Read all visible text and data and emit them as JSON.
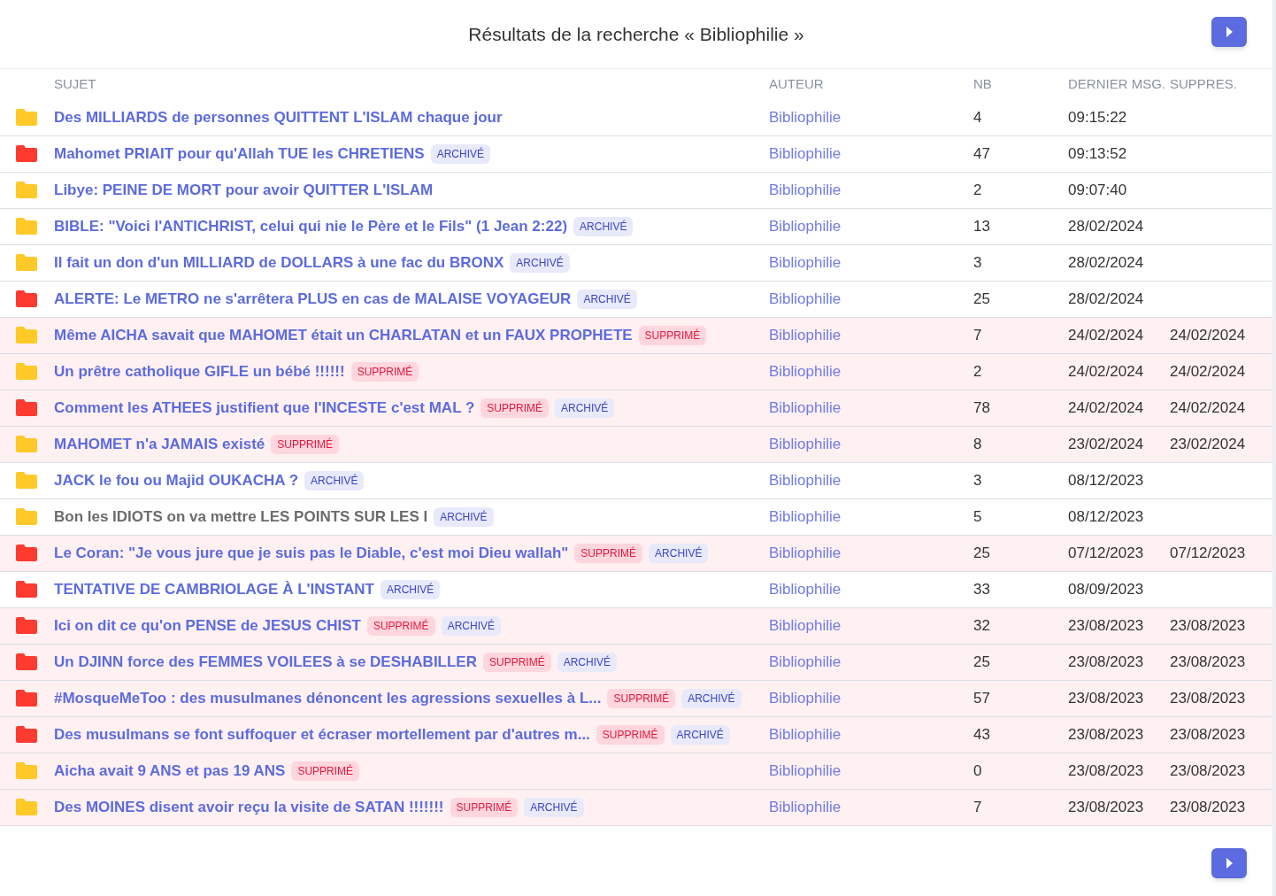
{
  "title": "Résultats de la recherche « Bibliophilie »",
  "columns": [
    "SUJET",
    "AUTEUR",
    "NB",
    "DERNIER MSG.",
    "SUPPRES."
  ],
  "rows": [
    {
      "color": "#ffc928",
      "subject": "Des MILLIARDS de personnes QUITTENT L'ISLAM chaque jour",
      "visited": false,
      "deleted": false,
      "badges": [],
      "author": "Bibliophilie",
      "count": "4",
      "last": "09:15:22"
    },
    {
      "color": "#ff3b2f",
      "subject": "Mahomet PRIAIT pour qu'Allah TUE les CHRETIENS",
      "visited": false,
      "deleted": false,
      "badges": [
        {
          "kind": "archived",
          "label": "ARCHIVÉ"
        }
      ],
      "author": "Bibliophilie",
      "count": "47",
      "last": "09:13:52"
    },
    {
      "color": "#ffc928",
      "subject": "Libye: PEINE DE MORT pour avoir QUITTER L'ISLAM",
      "visited": false,
      "deleted": false,
      "badges": [],
      "author": "Bibliophilie",
      "count": "2",
      "last": "09:07:40"
    },
    {
      "color": "#ffc928",
      "subject": "BIBLE: \"Voici l'ANTICHRIST, celui qui nie le Père et le Fils\" (1 Jean 2:22)",
      "visited": false,
      "deleted": false,
      "badges": [
        {
          "kind": "archived",
          "label": "ARCHIVÉ"
        }
      ],
      "author": "Bibliophilie",
      "count": "13",
      "last": "28/02/2024"
    },
    {
      "color": "#ffc928",
      "subject": "Il fait un don d'un MILLIARD de DOLLARS à une fac du BRONX",
      "visited": false,
      "deleted": false,
      "badges": [
        {
          "kind": "archived",
          "label": "ARCHIVÉ"
        }
      ],
      "author": "Bibliophilie",
      "count": "3",
      "last": "28/02/2024"
    },
    {
      "color": "#ff3b2f",
      "subject": "ALERTE: Le METRO ne s'arrêtera PLUS en cas de MALAISE VOYAGEUR",
      "visited": false,
      "deleted": false,
      "badges": [
        {
          "kind": "archived",
          "label": "ARCHIVÉ"
        }
      ],
      "author": "Bibliophilie",
      "count": "25",
      "last": "28/02/2024"
    },
    {
      "color": "#ffc928",
      "subject": "Même AICHA savait que MAHOMET était un CHARLATAN et un FAUX PROPHETE",
      "visited": false,
      "deleted": true,
      "badges": [
        {
          "kind": "deleted",
          "label": "SUPPRIMÉ"
        }
      ],
      "author": "Bibliophilie",
      "count": "7",
      "last": "24/02/2024",
      "removed": "24/02/2024"
    },
    {
      "color": "#ffc928",
      "subject": "Un prêtre catholique GIFLE un bébé !!!!!!",
      "visited": false,
      "deleted": true,
      "badges": [
        {
          "kind": "deleted",
          "label": "SUPPRIMÉ"
        }
      ],
      "author": "Bibliophilie",
      "count": "2",
      "last": "24/02/2024",
      "removed": "24/02/2024"
    },
    {
      "color": "#ff3b2f",
      "subject": "Comment les ATHEES justifient que l'INCESTE c'est MAL ?",
      "visited": false,
      "deleted": true,
      "badges": [
        {
          "kind": "deleted",
          "label": "SUPPRIMÉ"
        },
        {
          "kind": "archived",
          "label": "ARCHIVÉ"
        }
      ],
      "author": "Bibliophilie",
      "count": "78",
      "last": "24/02/2024",
      "removed": "24/02/2024"
    },
    {
      "color": "#ffc928",
      "subject": "MAHOMET n'a JAMAIS existé",
      "visited": false,
      "deleted": true,
      "badges": [
        {
          "kind": "deleted",
          "label": "SUPPRIMÉ"
        }
      ],
      "author": "Bibliophilie",
      "count": "8",
      "last": "23/02/2024",
      "removed": "23/02/2024"
    },
    {
      "color": "#ffc928",
      "subject": "JACK le fou ou Majid OUKACHA ?",
      "visited": false,
      "deleted": false,
      "badges": [
        {
          "kind": "archived",
          "label": "ARCHIVÉ"
        }
      ],
      "author": "Bibliophilie",
      "count": "3",
      "last": "08/12/2023"
    },
    {
      "color": "#ffc928",
      "subject": "Bon les IDIOTS on va mettre LES POINTS SUR LES I",
      "visited": true,
      "deleted": false,
      "badges": [
        {
          "kind": "archived",
          "label": "ARCHIVÉ"
        }
      ],
      "author": "Bibliophilie",
      "count": "5",
      "last": "08/12/2023"
    },
    {
      "color": "#ff3b2f",
      "subject": "Le Coran: \"Je vous jure que je suis pas le Diable, c'est moi Dieu wallah\"",
      "visited": false,
      "deleted": true,
      "badges": [
        {
          "kind": "deleted",
          "label": "SUPPRIMÉ"
        },
        {
          "kind": "archived",
          "label": "ARCHIVÉ"
        }
      ],
      "author": "Bibliophilie",
      "count": "25",
      "last": "07/12/2023",
      "removed": "07/12/2023"
    },
    {
      "color": "#ff3b2f",
      "subject": "TENTATIVE DE CAMBRIOLAGE À L'INSTANT",
      "visited": false,
      "deleted": false,
      "badges": [
        {
          "kind": "archived",
          "label": "ARCHIVÉ"
        }
      ],
      "author": "Bibliophilie",
      "count": "33",
      "last": "08/09/2023"
    },
    {
      "color": "#ff3b2f",
      "subject": "Ici on dit ce qu'on PENSE de JESUS CHIST",
      "visited": false,
      "deleted": true,
      "badges": [
        {
          "kind": "deleted",
          "label": "SUPPRIMÉ"
        },
        {
          "kind": "archived",
          "label": "ARCHIVÉ"
        }
      ],
      "author": "Bibliophilie",
      "count": "32",
      "last": "23/08/2023",
      "removed": "23/08/2023"
    },
    {
      "color": "#ff3b2f",
      "subject": "Un DJINN force des FEMMES VOILEES à se DESHABILLER",
      "visited": false,
      "deleted": true,
      "badges": [
        {
          "kind": "deleted",
          "label": "SUPPRIMÉ"
        },
        {
          "kind": "archived",
          "label": "ARCHIVÉ"
        }
      ],
      "author": "Bibliophilie",
      "count": "25",
      "last": "23/08/2023",
      "removed": "23/08/2023"
    },
    {
      "color": "#ff3b2f",
      "subject": "#MosqueMeToo : des musulmanes dénoncent les agressions sexuelles à L...",
      "visited": false,
      "deleted": true,
      "badges": [
        {
          "kind": "deleted",
          "label": "SUPPRIMÉ"
        },
        {
          "kind": "archived",
          "label": "ARCHIVÉ"
        }
      ],
      "author": "Bibliophilie",
      "count": "57",
      "last": "23/08/2023",
      "removed": "23/08/2023"
    },
    {
      "color": "#ff3b2f",
      "subject": "Des musulmans se font suffoquer et écraser mortellement par d'autres m...",
      "visited": false,
      "deleted": true,
      "badges": [
        {
          "kind": "deleted",
          "label": "SUPPRIMÉ"
        },
        {
          "kind": "archived",
          "label": "ARCHIVÉ"
        }
      ],
      "author": "Bibliophilie",
      "count": "43",
      "last": "23/08/2023",
      "removed": "23/08/2023"
    },
    {
      "color": "#ffc928",
      "subject": "Aicha avait 9 ANS et pas 19 ANS",
      "visited": false,
      "deleted": true,
      "badges": [
        {
          "kind": "deleted",
          "label": "SUPPRIMÉ"
        }
      ],
      "author": "Bibliophilie",
      "count": "0",
      "last": "23/08/2023",
      "removed": "23/08/2023"
    },
    {
      "color": "#ffc928",
      "subject": "Des MOINES disent avoir reçu la visite de SATAN !!!!!!!",
      "visited": false,
      "deleted": true,
      "badges": [
        {
          "kind": "deleted",
          "label": "SUPPRIMÉ"
        },
        {
          "kind": "archived",
          "label": "ARCHIVÉ"
        }
      ],
      "author": "Bibliophilie",
      "count": "7",
      "last": "23/08/2023",
      "removed": "23/08/2023"
    }
  ]
}
